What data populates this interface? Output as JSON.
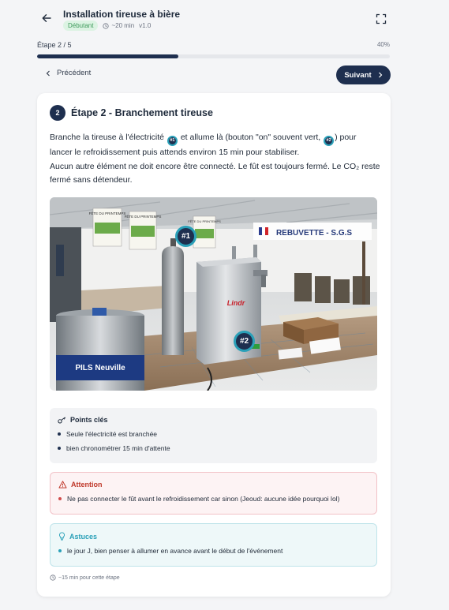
{
  "header": {
    "title": "Installation tireuse à bière",
    "level_badge": "Débutant",
    "duration": "~20 min",
    "version": "v1.0"
  },
  "progress": {
    "step_label": "Étape 2 / 5",
    "percent_label": "40%",
    "percent": 40
  },
  "nav": {
    "prev_label": "Précédent",
    "next_label": "Suivant"
  },
  "step": {
    "number": "2",
    "title": "Étape 2 - Branchement tireuse",
    "desc_1a": "Branche la tireuse à l'électricité",
    "desc_1b": "et allume là (bouton \"on\" souvent vert,",
    "desc_1c": ") pour lancer le refroidissement puis attends environ 15 min pour stabiliser.",
    "desc_2": "Aucun autre élément ne doit encore être connecté. Le fût est toujours fermé. Le CO₂ reste fermé sans détendeur.",
    "inline_markers": [
      "#1",
      "#2"
    ]
  },
  "photo": {
    "markers": [
      "#1",
      "#2"
    ],
    "signs": [
      "FÊTE DU PRINTEMPS",
      "FÊTE DU PRINTEMPS",
      "FÊTE DU PRINTEMPS"
    ],
    "banner": "REBUVETTE - S.G.S",
    "keg_label": "PILS Neuville",
    "machine_brand": "Lindr"
  },
  "key_points": {
    "title": "Points clés",
    "items": [
      "Seule l'électricité est branchée",
      "bien chronométrer 15 min d'attente"
    ]
  },
  "warning": {
    "title": "Attention",
    "items": [
      "Ne pas connecter le fût avant le refroidissement car sinon (Jeoud: aucune idée pourquoi lol)"
    ]
  },
  "tips": {
    "title": "Astuces",
    "items": [
      "le jour J, bien penser à allumer en avance avant le début de l'événement"
    ]
  },
  "footer": {
    "note": "~15 min pour cette étape"
  },
  "colors": {
    "primary": "#1e2f4f",
    "accent": "#2aa0b8",
    "success": "#3e9a5b",
    "danger": "#c0392b"
  }
}
